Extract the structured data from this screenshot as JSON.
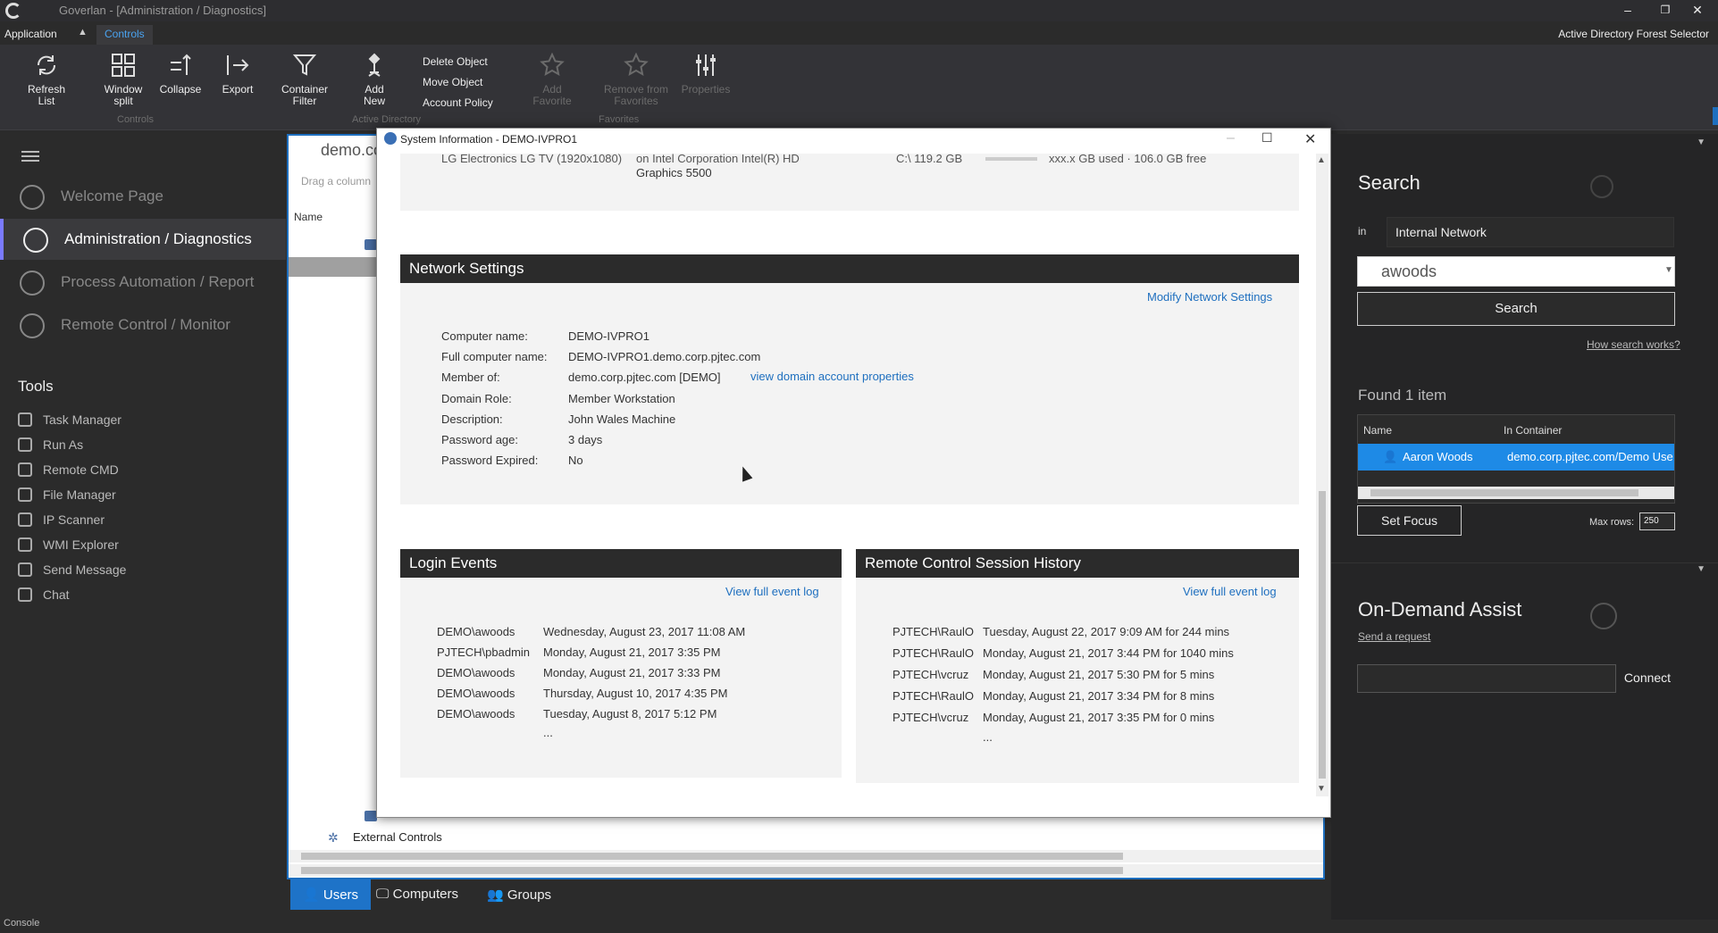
{
  "titlebar": {
    "title": "Goverlan - [Administration / Diagnostics]",
    "minimize": "–",
    "restore": "❐",
    "close": "✕"
  },
  "ribbon": {
    "menu_app": "Application",
    "menu_caret": "▲",
    "menu_controls": "Controls",
    "forest_selector": "Active Directory Forest Selector",
    "buttons": {
      "refresh": "Refresh List",
      "window_split": "Window split",
      "collapse": "Collapse",
      "export": "Export",
      "container_filter": "Container Filter",
      "add_new": "Add New",
      "add_favorite": "Add Favorite",
      "remove_favorites": "Remove from Favorites",
      "properties": "Properties"
    },
    "small_buttons": [
      "Delete Object",
      "Move Object",
      "Account Policy"
    ],
    "groups": {
      "controls": "Controls",
      "active_directory": "Active Directory",
      "favorites": "Favorites"
    }
  },
  "leftnav": {
    "items": [
      {
        "label": "Welcome Page",
        "icon": "start-icon"
      },
      {
        "label": "Administration / Diagnostics",
        "icon": "admin-icon"
      },
      {
        "label": "Process Automation / Report",
        "icon": "process-icon"
      },
      {
        "label": "Remote Control / Monitor",
        "icon": "remote-icon"
      }
    ],
    "tools_title": "Tools",
    "tools": [
      "Task Manager",
      "Run As",
      "Remote CMD",
      "File Manager",
      "IP Scanner",
      "WMI Explorer",
      "Send Message",
      "Chat"
    ]
  },
  "center": {
    "tab_title": "demo.co",
    "drag_hint": "Drag a column",
    "col_name": "Name",
    "external_controls": "External Controls"
  },
  "bottom_tabs": [
    "Users",
    "Computers",
    "Groups"
  ],
  "console_label": "Console",
  "modal": {
    "title": "System Information - DEMO-IVPRO1",
    "top_partial": {
      "left": "LG Electronics LG TV (1920x1080)",
      "mid1": "on Intel Corporation Intel(R) HD",
      "mid2": "Graphics 5500",
      "right": "C:\\ 119.2 GB",
      "usage": "xxx.x GB used · 106.0 GB free"
    },
    "network": {
      "header": "Network Settings",
      "modify_link": "Modify Network Settings",
      "fields": [
        {
          "key": "Computer name:",
          "value": "DEMO-IVPRO1"
        },
        {
          "key": "Full computer name:",
          "value": "DEMO-IVPRO1.demo.corp.pjtec.com"
        },
        {
          "key": "Member of:",
          "value": "demo.corp.pjtec.com [DEMO]"
        },
        {
          "key": "Domain Role:",
          "value": "Member Workstation"
        },
        {
          "key": "Description:",
          "value": "John Wales Machine"
        },
        {
          "key": "Password age:",
          "value": "3 days"
        },
        {
          "key": "Password Expired:",
          "value": "No"
        }
      ],
      "domain_link": "view domain account properties"
    },
    "login_events": {
      "header": "Login Events",
      "link": "View full event log",
      "rows": [
        {
          "user": "DEMO\\awoods",
          "time": "Wednesday, August 23, 2017 11:08 AM"
        },
        {
          "user": "PJTECH\\pbadmin",
          "time": "Monday, August 21, 2017 3:35 PM"
        },
        {
          "user": "DEMO\\awoods",
          "time": "Monday, August 21, 2017 3:33 PM"
        },
        {
          "user": "DEMO\\awoods",
          "time": "Thursday, August 10, 2017 4:35 PM"
        },
        {
          "user": "DEMO\\awoods",
          "time": "Tuesday, August 8, 2017 5:12 PM"
        }
      ],
      "more": "..."
    },
    "remote_history": {
      "header": "Remote Control Session History",
      "link": "View full event log",
      "rows": [
        {
          "user": "PJTECH\\RaulO",
          "time": "Tuesday, August 22, 2017 9:09 AM for 244 mins"
        },
        {
          "user": "PJTECH\\RaulO",
          "time": "Monday, August 21, 2017 3:44 PM for 1040 mins"
        },
        {
          "user": "PJTECH\\vcruz",
          "time": "Monday, August 21, 2017 5:30 PM for 5 mins"
        },
        {
          "user": "PJTECH\\RaulO",
          "time": "Monday, August 21, 2017 3:34 PM for 8 mins"
        },
        {
          "user": "PJTECH\\vcruz",
          "time": "Monday, August 21, 2017 3:35 PM for 0 mins"
        }
      ],
      "more": "..."
    }
  },
  "search_panel": {
    "title": "Search",
    "in_label": "in",
    "in_value": "Internal Network",
    "query": "awoods",
    "search_button": "Search",
    "how_link": "How search works?",
    "found": "Found 1 item",
    "columns": [
      "Name",
      "In Container"
    ],
    "result": {
      "name": "Aaron Woods",
      "container": "demo.corp.pjtec.com/Demo Use"
    },
    "set_focus": "Set Focus",
    "max_rows_label": "Max rows:",
    "max_rows_value": "250"
  },
  "assist_panel": {
    "title": "On-Demand Assist",
    "send_request": "Send a request",
    "connect": "Connect"
  },
  "colors": {
    "accent": "#1e73c8",
    "selection": "#1e8ae6",
    "dark_bg": "#2b2b2b",
    "header_bg": "#2b2b2b"
  }
}
